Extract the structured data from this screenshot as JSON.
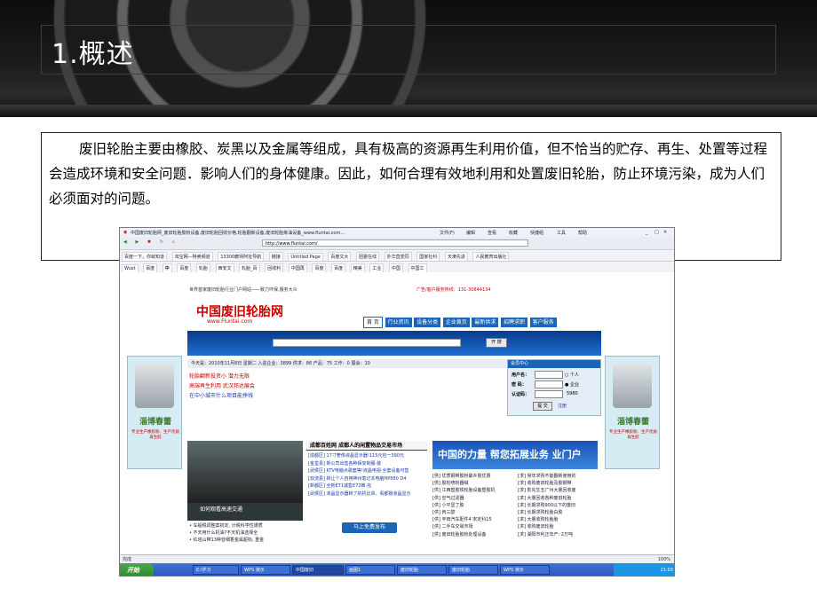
{
  "slide": {
    "title": "1.概述",
    "paragraph": "废旧轮胎主要由橡胶、炭黑以及金属等组成，具有极高的资源再生利用价值，但不恰当的贮存、再生、处置等过程会造成环境和安全问题．影响人们的身体健康。因此，如何合理有效地利用和处置废旧轮胎，防止环境污染，成为人们必须面对的问题。"
  },
  "browser": {
    "window_title": "中国废旧轮胎网_废旧轮胎胶粉设备,废旧轮胎回收价格,轮胎翻新设备,废旧轮胎炼油设备_www.fluntai.com...",
    "menu": [
      "文件(F)",
      "编辑",
      "查看",
      "收藏",
      "快捷组",
      "工具",
      "帮助"
    ],
    "address": "http://www.fluntai.com/",
    "favorites": [
      "百度一下，你就知道",
      "淘宝网—特卖频道",
      "13300教师阿址导航",
      "链接",
      "Untitled Page",
      "百度文大",
      "团委在线",
      "外华直党同",
      "国家社科",
      "天津先进",
      "人民教育出版社"
    ],
    "tabs": [
      "Wust",
      "百度",
      "中",
      "百度",
      "轧胎",
      "西安文",
      "轧胎_百",
      "回收利",
      "中国再",
      "百度",
      "百度",
      "精美",
      "工业",
      "中国",
      "中国工"
    ],
    "status": "完成",
    "zoom": "100%"
  },
  "site": {
    "logo": "中国废旧轮胎网",
    "logo_url": "www.Fluntai.com",
    "slogan": "世界首家废旧轮胎行业门户网站——致力环保,服务大众",
    "hotline": "广告/客户服务热线：131-30844134",
    "nav": [
      "首 页",
      "行业资讯",
      "设备分类",
      "企业黄页",
      "最新供求",
      "招聘求职",
      "客户服务"
    ],
    "search_button": "开 搜",
    "date_line": "今天是：2010年11月8日 星期二   入驻企业：3899  供求：86  产品：75  工作：0  展会：10",
    "promo_links": [
      "轮胎翻新投资小 潜力无限",
      "高端再生利用 武汉邦达展会",
      "在中小城市什么项目能挣钱"
    ],
    "login": {
      "header": "会员中心",
      "username_label": "用户名：",
      "password_label": "密  码：",
      "code_label": "认证码：",
      "code": "5980",
      "personal": "个人",
      "company": "企业",
      "submit": "提 交",
      "register": "注册"
    },
    "news_header": "成都百姓网  成都人的闲置物品交易市场",
    "news": [
      "[成都区] 17寸奢侈液晶显示器!115元包一390元",
      "[金堂县] 新公司出售各种保安制服·装",
      "[武侯区] KTV电脑点歌套等!液晶电视·全套设备可售",
      "[双流县] 转让个人自用神州笔记本电脑HP880 D4",
      "[新都区] 全新E71诚售E72推·完",
      "[武侯区] 液晶显示器转了的机比资。看都摄液晶显示"
    ],
    "video_caption": "如何观看高速交通",
    "video_news": [
      "车船税调整案初定, 计税科学性遭质",
      "不天用什么机油?不天机油选择全",
      "红塔山带13种音细香金属超标, 重金"
    ],
    "publish_button": "马上免费发布",
    "china_banner": "中国的力量 帮您拓展业务  业门户",
    "right_list": [
      "[供] 优质钢带胶粉破乡胶优惠",
      "[供] 胶轮喷粉器械",
      "[供] 江西塑胶铁轮胎设备塑胶机",
      "[供] 空气过滤器",
      "[供] 小平显丁胶",
      "[供] 丙三醇",
      "[供] 丰田汽车配件4 宋定科15",
      "[供] 二手车交易市场",
      "[供] 废旧轮胎胶粉处理设备"
    ],
    "right_list2": [
      "[求] 常年求购不能翻新使用的",
      "[求] 收购废旧轮胎及胶钢带",
      "[求] 影先生五广州大量回收废",
      "[求] 大量回收各种废旧轮胎",
      "[求] 长期求购900以下的废旧",
      "[求] 长期求购轮胎白胶",
      "[求] 大量收购轮胎胎",
      "[求] 收购废旧轮胎",
      "[求] 湖阳市利正年产: 2万吨"
    ],
    "side_ad_text": "淄博春蕾",
    "side_ad_sub": "专业生产橡胶粉、生产优质再生胶"
  },
  "taskbar": {
    "start": "开始",
    "tasks": [
      "E:\\学习",
      "WPS 演示",
      "中国废旧",
      "画图1",
      "废旧轮胎",
      "废旧轮胎",
      "WPS 演示"
    ],
    "clock": "21:03"
  }
}
